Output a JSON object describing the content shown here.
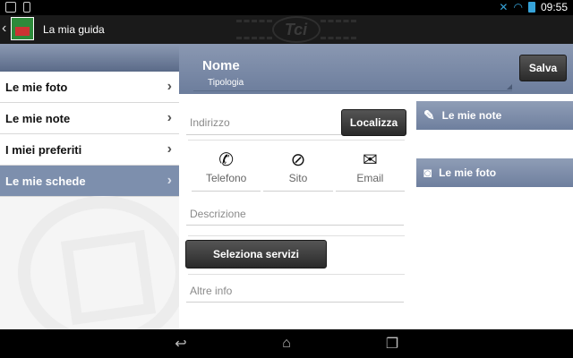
{
  "status_bar": {
    "time": "09:55",
    "icons": [
      "image-icon",
      "phone-icon",
      "signal-icon",
      "wifi-icon",
      "battery-icon"
    ]
  },
  "action_bar": {
    "title": "La mia guida",
    "watermark": "Tci"
  },
  "sidebar": {
    "items": [
      {
        "label": "Le mie foto",
        "selected": false
      },
      {
        "label": "Le mie note",
        "selected": false
      },
      {
        "label": "I miei preferiti",
        "selected": false
      },
      {
        "label": "Le mie schede",
        "selected": true
      }
    ]
  },
  "form": {
    "nome": "Nome",
    "tipologia": "Tipologia",
    "save_label": "Salva",
    "indirizzo_placeholder": "Indirizzo",
    "localizza_label": "Localizza",
    "contacts": [
      {
        "label": "Telefono",
        "icon": "phone-icon"
      },
      {
        "label": "Sito",
        "icon": "compass-icon"
      },
      {
        "label": "Email",
        "icon": "envelope-icon"
      }
    ],
    "descrizione_placeholder": "Descrizione",
    "seleziona_label": "Seleziona servizi",
    "altre_info_placeholder": "Altre info"
  },
  "side_cards": {
    "note_label": "Le mie note",
    "foto_label": "Le mie foto"
  },
  "colors": {
    "accent": "#7d8fad",
    "button_dark": "#2a2a2a",
    "status_blue": "#36a3d9"
  }
}
